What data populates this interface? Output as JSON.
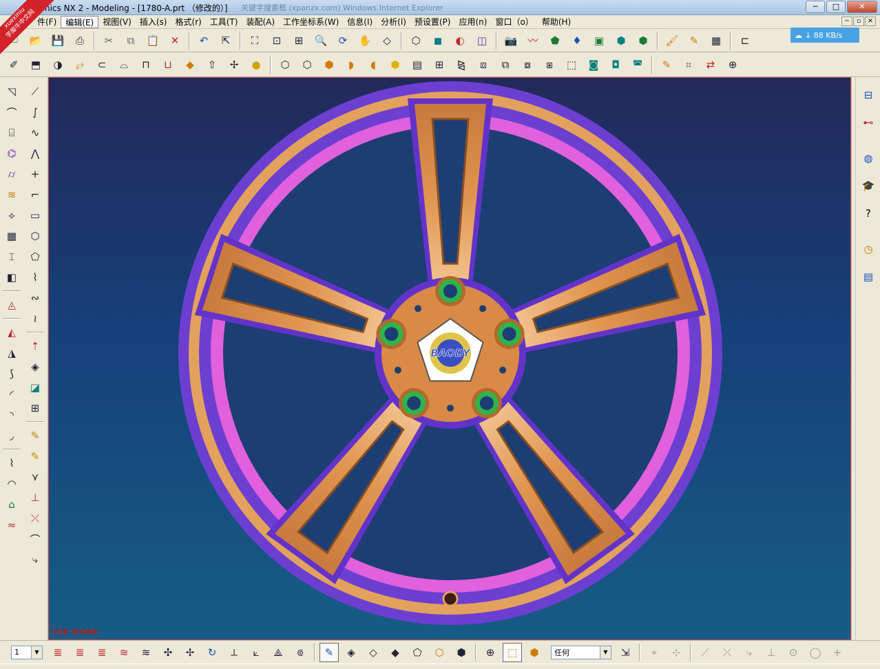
{
  "window": {
    "title": "aphics NX 2 - Modeling - [1780-A.prt （修改的）]",
    "ghost_text": "关键字搜索框 (xpanzx.com) Windows Internet Explorer",
    "buttons": {
      "minimize": "─",
      "maximize": "□",
      "close": "✕"
    }
  },
  "watermark": {
    "brand": "xuexiniu",
    "tagline": "学犀牛中文网"
  },
  "menu": {
    "items": [
      {
        "label": "件(F)"
      },
      {
        "label": "编辑(E)",
        "active": true
      },
      {
        "label": "视图(V)"
      },
      {
        "label": "插入(s)"
      },
      {
        "label": "格式(r)"
      },
      {
        "label": "工具(T)"
      },
      {
        "label": "装配(A)"
      },
      {
        "label": "工作坐标系(W)"
      },
      {
        "label": "信息(I)"
      },
      {
        "label": "分析(l)"
      },
      {
        "label": "预设置(P)"
      },
      {
        "label": "应用(n)"
      },
      {
        "label": "窗口（o）"
      },
      {
        "label": "帮助(H)"
      }
    ],
    "mdi_buttons": [
      "─",
      "▫",
      "✕"
    ]
  },
  "network": {
    "speed": "↓ 88 KB/s"
  },
  "toolbar_top": {
    "icons": [
      {
        "name": "new-file-icon",
        "glyph": "🗋",
        "color": "#223"
      },
      {
        "name": "open-folder-icon",
        "glyph": "📂",
        "color": "#d27b00"
      },
      {
        "name": "save-icon",
        "glyph": "💾",
        "color": "#1a4fb8"
      },
      {
        "name": "print-icon",
        "glyph": "⎙",
        "color": "#223"
      },
      {
        "name": "sep"
      },
      {
        "name": "cut-icon",
        "glyph": "✂",
        "color": "#666"
      },
      {
        "name": "copy-icon",
        "glyph": "⧉",
        "color": "#666"
      },
      {
        "name": "paste-icon",
        "glyph": "📋",
        "color": "#666"
      },
      {
        "name": "delete-icon",
        "glyph": "✕",
        "color": "#c1272d"
      },
      {
        "name": "sep"
      },
      {
        "name": "undo-icon",
        "glyph": "↶",
        "color": "#1a4fb8"
      },
      {
        "name": "select-cursor-icon",
        "glyph": "⇱",
        "color": "#223"
      },
      {
        "name": "sep"
      },
      {
        "name": "fit-view-icon",
        "glyph": "⛶",
        "color": "#223"
      },
      {
        "name": "zoom-window-icon",
        "glyph": "⊡",
        "color": "#223"
      },
      {
        "name": "zoom-box-icon",
        "glyph": "⊞",
        "color": "#223"
      },
      {
        "name": "zoom-icon",
        "glyph": "🔍",
        "color": "#223"
      },
      {
        "name": "rotate-icon",
        "glyph": "⟳",
        "color": "#1a4fb8"
      },
      {
        "name": "pan-icon",
        "glyph": "✋",
        "color": "#223"
      },
      {
        "name": "perspective-icon",
        "glyph": "◇",
        "color": "#223"
      },
      {
        "name": "sep"
      },
      {
        "name": "view-orient-icon",
        "glyph": "⬡",
        "color": "#223"
      },
      {
        "name": "shaded-cube-icon",
        "glyph": "◼",
        "color": "#0e7f80"
      },
      {
        "name": "render-style-icon",
        "glyph": "◐",
        "color": "#c1272d"
      },
      {
        "name": "layer-icon",
        "glyph": "◫",
        "color": "#6a2bb2"
      },
      {
        "name": "sep"
      },
      {
        "name": "camera-icon",
        "glyph": "📷",
        "color": "#223"
      },
      {
        "name": "curve-analysis-icon",
        "glyph": "〰",
        "color": "#c1272d"
      },
      {
        "name": "material-icon",
        "glyph": "⬟",
        "color": "#1f7a32"
      },
      {
        "name": "lighting-icon",
        "glyph": "♦",
        "color": "#1a4fb8"
      },
      {
        "name": "texture-icon",
        "glyph": "▣",
        "color": "#1f7a32"
      },
      {
        "name": "render-box-icon",
        "glyph": "⬢",
        "color": "#0e7f80"
      },
      {
        "name": "render-cube-icon",
        "glyph": "⬢",
        "color": "#1f7a32"
      },
      {
        "name": "sep"
      },
      {
        "name": "brush-icon",
        "glyph": "🖌",
        "color": "#d27b00"
      },
      {
        "name": "highlight-icon",
        "glyph": "✎",
        "color": "#d27b00"
      },
      {
        "name": "grid-icon",
        "glyph": "▦",
        "color": "#223"
      },
      {
        "name": "sep"
      },
      {
        "name": "measure-icon",
        "glyph": "⊏",
        "color": "#223"
      }
    ]
  },
  "toolbar_second": {
    "icons": [
      {
        "name": "sketch-icon",
        "glyph": "✐",
        "color": "#223"
      },
      {
        "name": "extrude-icon",
        "glyph": "⬒",
        "color": "#223"
      },
      {
        "name": "revolve-icon",
        "glyph": "◑",
        "color": "#223"
      },
      {
        "name": "sweep-icon",
        "glyph": "⥂",
        "color": "#d27b00"
      },
      {
        "name": "tube-icon",
        "glyph": "⊂",
        "color": "#223"
      },
      {
        "name": "hole-icon",
        "glyph": "⌓",
        "color": "#223"
      },
      {
        "name": "boss-icon",
        "glyph": "⊓",
        "color": "#223"
      },
      {
        "name": "pocket-icon",
        "glyph": "⊔",
        "color": "#c1272d"
      },
      {
        "name": "pad-icon",
        "glyph": "◆",
        "color": "#d27b00"
      },
      {
        "name": "datum-plane-icon",
        "glyph": "⇧",
        "color": "#223"
      },
      {
        "name": "datum-axis-icon",
        "glyph": "✢",
        "color": "#223"
      },
      {
        "name": "datum-csys-icon",
        "glyph": "●",
        "color": "#d2a100"
      },
      {
        "name": "sep"
      },
      {
        "name": "block-icon",
        "glyph": "⬡",
        "color": "#223"
      },
      {
        "name": "cylinder-icon",
        "glyph": "⬡",
        "color": "#223"
      },
      {
        "name": "cone-icon",
        "glyph": "⬢",
        "color": "#d27b00"
      },
      {
        "name": "sphere-icon",
        "glyph": "◗",
        "color": "#d27b00"
      },
      {
        "name": "blend-edge-icon",
        "glyph": "◖",
        "color": "#d27b00"
      },
      {
        "name": "chamfer-icon",
        "glyph": "⬢",
        "color": "#e3b000"
      },
      {
        "name": "shell-icon",
        "glyph": "▤",
        "color": "#223"
      },
      {
        "name": "pattern-icon",
        "glyph": "⊞",
        "color": "#223"
      },
      {
        "name": "mirror-icon",
        "glyph": "⧎",
        "color": "#223"
      },
      {
        "name": "trim-body-icon",
        "glyph": "⧈",
        "color": "#223"
      },
      {
        "name": "split-body-icon",
        "glyph": "⧉",
        "color": "#223"
      },
      {
        "name": "offset-face-icon",
        "glyph": "⧇",
        "color": "#223"
      },
      {
        "name": "scale-body-icon",
        "glyph": "⧆",
        "color": "#223"
      },
      {
        "name": "unite-icon",
        "glyph": "⬚",
        "color": "#223"
      },
      {
        "name": "subtract-icon",
        "glyph": "◙",
        "color": "#0e7f80"
      },
      {
        "name": "intersect-icon",
        "glyph": "◘",
        "color": "#0e7f80"
      },
      {
        "name": "sew-icon",
        "glyph": "◚",
        "color": "#0e7f80"
      },
      {
        "name": "sep"
      },
      {
        "name": "edit-feature-icon",
        "glyph": "✎",
        "color": "#d27b00"
      },
      {
        "name": "replace-feature-icon",
        "glyph": "⌗",
        "color": "#c1272d"
      },
      {
        "name": "move-feature-icon",
        "glyph": "⇄",
        "color": "#c1272d"
      },
      {
        "name": "suppress-feature-icon",
        "glyph": "⊕",
        "color": "#223"
      }
    ]
  },
  "left_toolbar_a": {
    "icons": [
      {
        "name": "through-curves-icon",
        "glyph": "◹",
        "color": "#223"
      },
      {
        "name": "ruled-surface-icon",
        "glyph": "⌒",
        "color": "#223"
      },
      {
        "name": "mesh-surface-icon",
        "glyph": "⌸",
        "color": "#223"
      },
      {
        "name": "swept-surface-icon",
        "glyph": "⌬",
        "color": "#6a2bb2"
      },
      {
        "name": "section-surface-icon",
        "glyph": "⌭",
        "color": "#6a2bb2"
      },
      {
        "name": "bounded-plane-icon",
        "glyph": "≋",
        "color": "#d27b00"
      },
      {
        "name": "offset-surface-icon",
        "glyph": "⟡",
        "color": "#223"
      },
      {
        "name": "from-point-cloud-icon",
        "glyph": "▦",
        "color": "#223"
      },
      {
        "name": "trimmed-sheet-icon",
        "glyph": "⌶",
        "color": "#223"
      },
      {
        "name": "extension-icon",
        "glyph": "◧",
        "color": "#223"
      },
      {
        "name": "sep"
      },
      {
        "name": "quilt-icon",
        "glyph": "◬",
        "color": "#c1272d"
      },
      {
        "name": "sep"
      },
      {
        "name": "law-extension-icon",
        "glyph": "◭",
        "color": "#c1272d"
      },
      {
        "name": "variable-offset-icon",
        "glyph": "◮",
        "color": "#223"
      },
      {
        "name": "global-shaping-icon",
        "glyph": "⟆",
        "color": "#223"
      },
      {
        "name": "x-form-icon",
        "glyph": "◜",
        "color": "#223"
      },
      {
        "name": "enlarge-icon",
        "glyph": "◝",
        "color": "#223"
      },
      {
        "name": "iso-trim-icon",
        "glyph": "◞",
        "color": "#223"
      },
      {
        "name": "sep"
      },
      {
        "name": "face-blend-icon",
        "glyph": "⌇",
        "color": "#223"
      },
      {
        "name": "soft-blend-icon",
        "glyph": "◠",
        "color": "#223"
      },
      {
        "name": "styled-blend-icon",
        "glyph": "⌂",
        "color": "#1f7a32"
      },
      {
        "name": "bridge-icon",
        "glyph": "≈",
        "color": "#c1272d"
      }
    ]
  },
  "left_toolbar_b": {
    "icons": [
      {
        "name": "point-icon",
        "glyph": "⟋",
        "color": "#223"
      },
      {
        "name": "line-icon",
        "glyph": "∫",
        "color": "#223"
      },
      {
        "name": "spline-icon",
        "glyph": "∿",
        "color": "#223"
      },
      {
        "name": "studio-spline-icon",
        "glyph": "⋀",
        "color": "#223"
      },
      {
        "name": "point-set-icon",
        "glyph": "+",
        "color": "#223"
      },
      {
        "name": "arc-icon",
        "glyph": "⌐",
        "color": "#223"
      },
      {
        "name": "rectangle-icon",
        "glyph": "▭",
        "color": "#223"
      },
      {
        "name": "polygon-icon",
        "glyph": "⬡",
        "color": "#223"
      },
      {
        "name": "ellipse-icon",
        "glyph": "⬠",
        "color": "#223"
      },
      {
        "name": "helix-icon",
        "glyph": "⌇",
        "color": "#223"
      },
      {
        "name": "law-curve-icon",
        "glyph": "∾",
        "color": "#223"
      },
      {
        "name": "text-curve-icon",
        "glyph": "≀",
        "color": "#223"
      },
      {
        "name": "sep"
      },
      {
        "name": "offset-curve-icon",
        "glyph": "⇡",
        "color": "#c1272d"
      },
      {
        "name": "bridge-curve-icon",
        "glyph": "◈",
        "color": "#223"
      },
      {
        "name": "project-curve-icon",
        "glyph": "◪",
        "color": "#0e7f80"
      },
      {
        "name": "combined-curve-icon",
        "glyph": "⊞",
        "color": "#223"
      },
      {
        "name": "sep"
      },
      {
        "name": "intersect-curve-icon",
        "glyph": "✎",
        "color": "#d27b00"
      },
      {
        "name": "section-curve-icon",
        "glyph": "✎",
        "color": "#d27b00"
      },
      {
        "name": "extract-curve-icon",
        "glyph": "⋎",
        "color": "#223"
      },
      {
        "name": "trim-curve-icon",
        "glyph": "⊥",
        "color": "#c1272d"
      },
      {
        "name": "divide-curve-icon",
        "glyph": "⤫",
        "color": "#c1272d"
      },
      {
        "name": "fillet-curve-icon",
        "glyph": "⌒",
        "color": "#223"
      },
      {
        "name": "edit-curve-icon",
        "glyph": "⤷",
        "color": "#223"
      }
    ]
  },
  "right_toolbar": {
    "icons": [
      {
        "name": "assembly-navigator-icon",
        "glyph": "⊟",
        "color": "#1a4fb8"
      },
      {
        "name": "part-navigator-icon",
        "glyph": "⊷",
        "color": "#c1272d"
      },
      {
        "name": "gap"
      },
      {
        "name": "internet-explorer-icon",
        "glyph": "◍",
        "color": "#1a4fb8"
      },
      {
        "name": "training-icon",
        "glyph": "🎓",
        "color": "#000"
      },
      {
        "name": "help-icon",
        "glyph": "?",
        "color": "#000"
      },
      {
        "name": "gap"
      },
      {
        "name": "history-icon",
        "glyph": "◷",
        "color": "#d27b00"
      },
      {
        "name": "system-materials-icon",
        "glyph": "▤",
        "color": "#1a4fb8"
      }
    ]
  },
  "viewport": {
    "overlay_text": "TOP WORK",
    "emblem_text": "BAODY",
    "colors": {
      "background_top": "#23295a",
      "background_bottom": "#165c86",
      "rim_outer": "#6c3fd1",
      "rim_inner": "#e060dd",
      "spoke": "#e0954f",
      "spoke_edge": "#6333c9",
      "lug_ring": "#2fb34a",
      "emblem_blue": "#3a4fc4",
      "emblem_gold": "#e0c34a"
    }
  },
  "bottom_toolbar": {
    "layer_value": "1",
    "filter_value": "任何",
    "icons_left": [
      {
        "name": "layer-settings-icon",
        "glyph": "≣",
        "color": "#c1272d"
      },
      {
        "name": "layer-visible-icon",
        "glyph": "≣",
        "color": "#c1272d"
      },
      {
        "name": "move-to-layer-icon",
        "glyph": "≣",
        "color": "#c1272d"
      },
      {
        "name": "copy-to-layer-icon",
        "glyph": "≋",
        "color": "#c1272d"
      },
      {
        "name": "layer-category-icon",
        "glyph": "≋",
        "color": "#223"
      },
      {
        "name": "wcs-origin-icon",
        "glyph": "✣",
        "color": "#223"
      },
      {
        "name": "wcs-dynamic-icon",
        "glyph": "✢",
        "color": "#223"
      },
      {
        "name": "wcs-rotate-icon",
        "glyph": "↻",
        "color": "#1a4fb8"
      },
      {
        "name": "wcs-orient-icon",
        "glyph": "⟂",
        "color": "#223"
      },
      {
        "name": "wcs-set-icon",
        "glyph": "⟀",
        "color": "#223"
      },
      {
        "name": "wcs-display-icon",
        "glyph": "⟁",
        "color": "#223"
      },
      {
        "name": "wcs-save-icon",
        "glyph": "⟃",
        "color": "#223"
      }
    ],
    "icons_mid": [
      {
        "name": "select-features-icon",
        "glyph": "✎",
        "color": "#1a4fb8",
        "pressed": true
      },
      {
        "name": "select-faces-icon",
        "glyph": "◈",
        "color": "#223"
      },
      {
        "name": "select-edges-icon",
        "glyph": "◇",
        "color": "#223"
      },
      {
        "name": "select-bodies-icon",
        "glyph": "◆",
        "color": "#223"
      },
      {
        "name": "select-components-icon",
        "glyph": "⬠",
        "color": "#223"
      },
      {
        "name": "select-sheet-icon",
        "glyph": "⬡",
        "color": "#d27b00"
      },
      {
        "name": "select-curve-icon",
        "glyph": "⬢",
        "color": "#223"
      }
    ],
    "icons_right": [
      {
        "name": "snap-point-icon",
        "glyph": "⊕",
        "color": "#223"
      },
      {
        "name": "snap-filter-icon",
        "glyph": "⬚",
        "color": "#d27b00",
        "pressed": true
      },
      {
        "name": "snap-cube-icon",
        "glyph": "⬢",
        "color": "#d27b00"
      }
    ],
    "icons_after_combo": [
      {
        "name": "select-by-name-icon",
        "glyph": "⇲",
        "color": "#223"
      },
      {
        "name": "sep"
      },
      {
        "name": "snap-end-icon",
        "glyph": "⌖",
        "color": "#999"
      },
      {
        "name": "snap-mid-icon",
        "glyph": "⊹",
        "color": "#999"
      },
      {
        "name": "sep"
      },
      {
        "name": "line-tool-icon",
        "glyph": "⟋",
        "color": "#999"
      },
      {
        "name": "arc-tool-icon",
        "glyph": "⤫",
        "color": "#999"
      },
      {
        "name": "curve-tool-icon",
        "glyph": "⤷",
        "color": "#999"
      },
      {
        "name": "perpendicular-tool-icon",
        "glyph": "⊥",
        "color": "#999"
      },
      {
        "name": "center-tool-icon",
        "glyph": "⊙",
        "color": "#999"
      },
      {
        "name": "circle-tool-icon",
        "glyph": "◯",
        "color": "#999"
      },
      {
        "name": "cross-tool-icon",
        "glyph": "+",
        "color": "#999"
      }
    ]
  }
}
